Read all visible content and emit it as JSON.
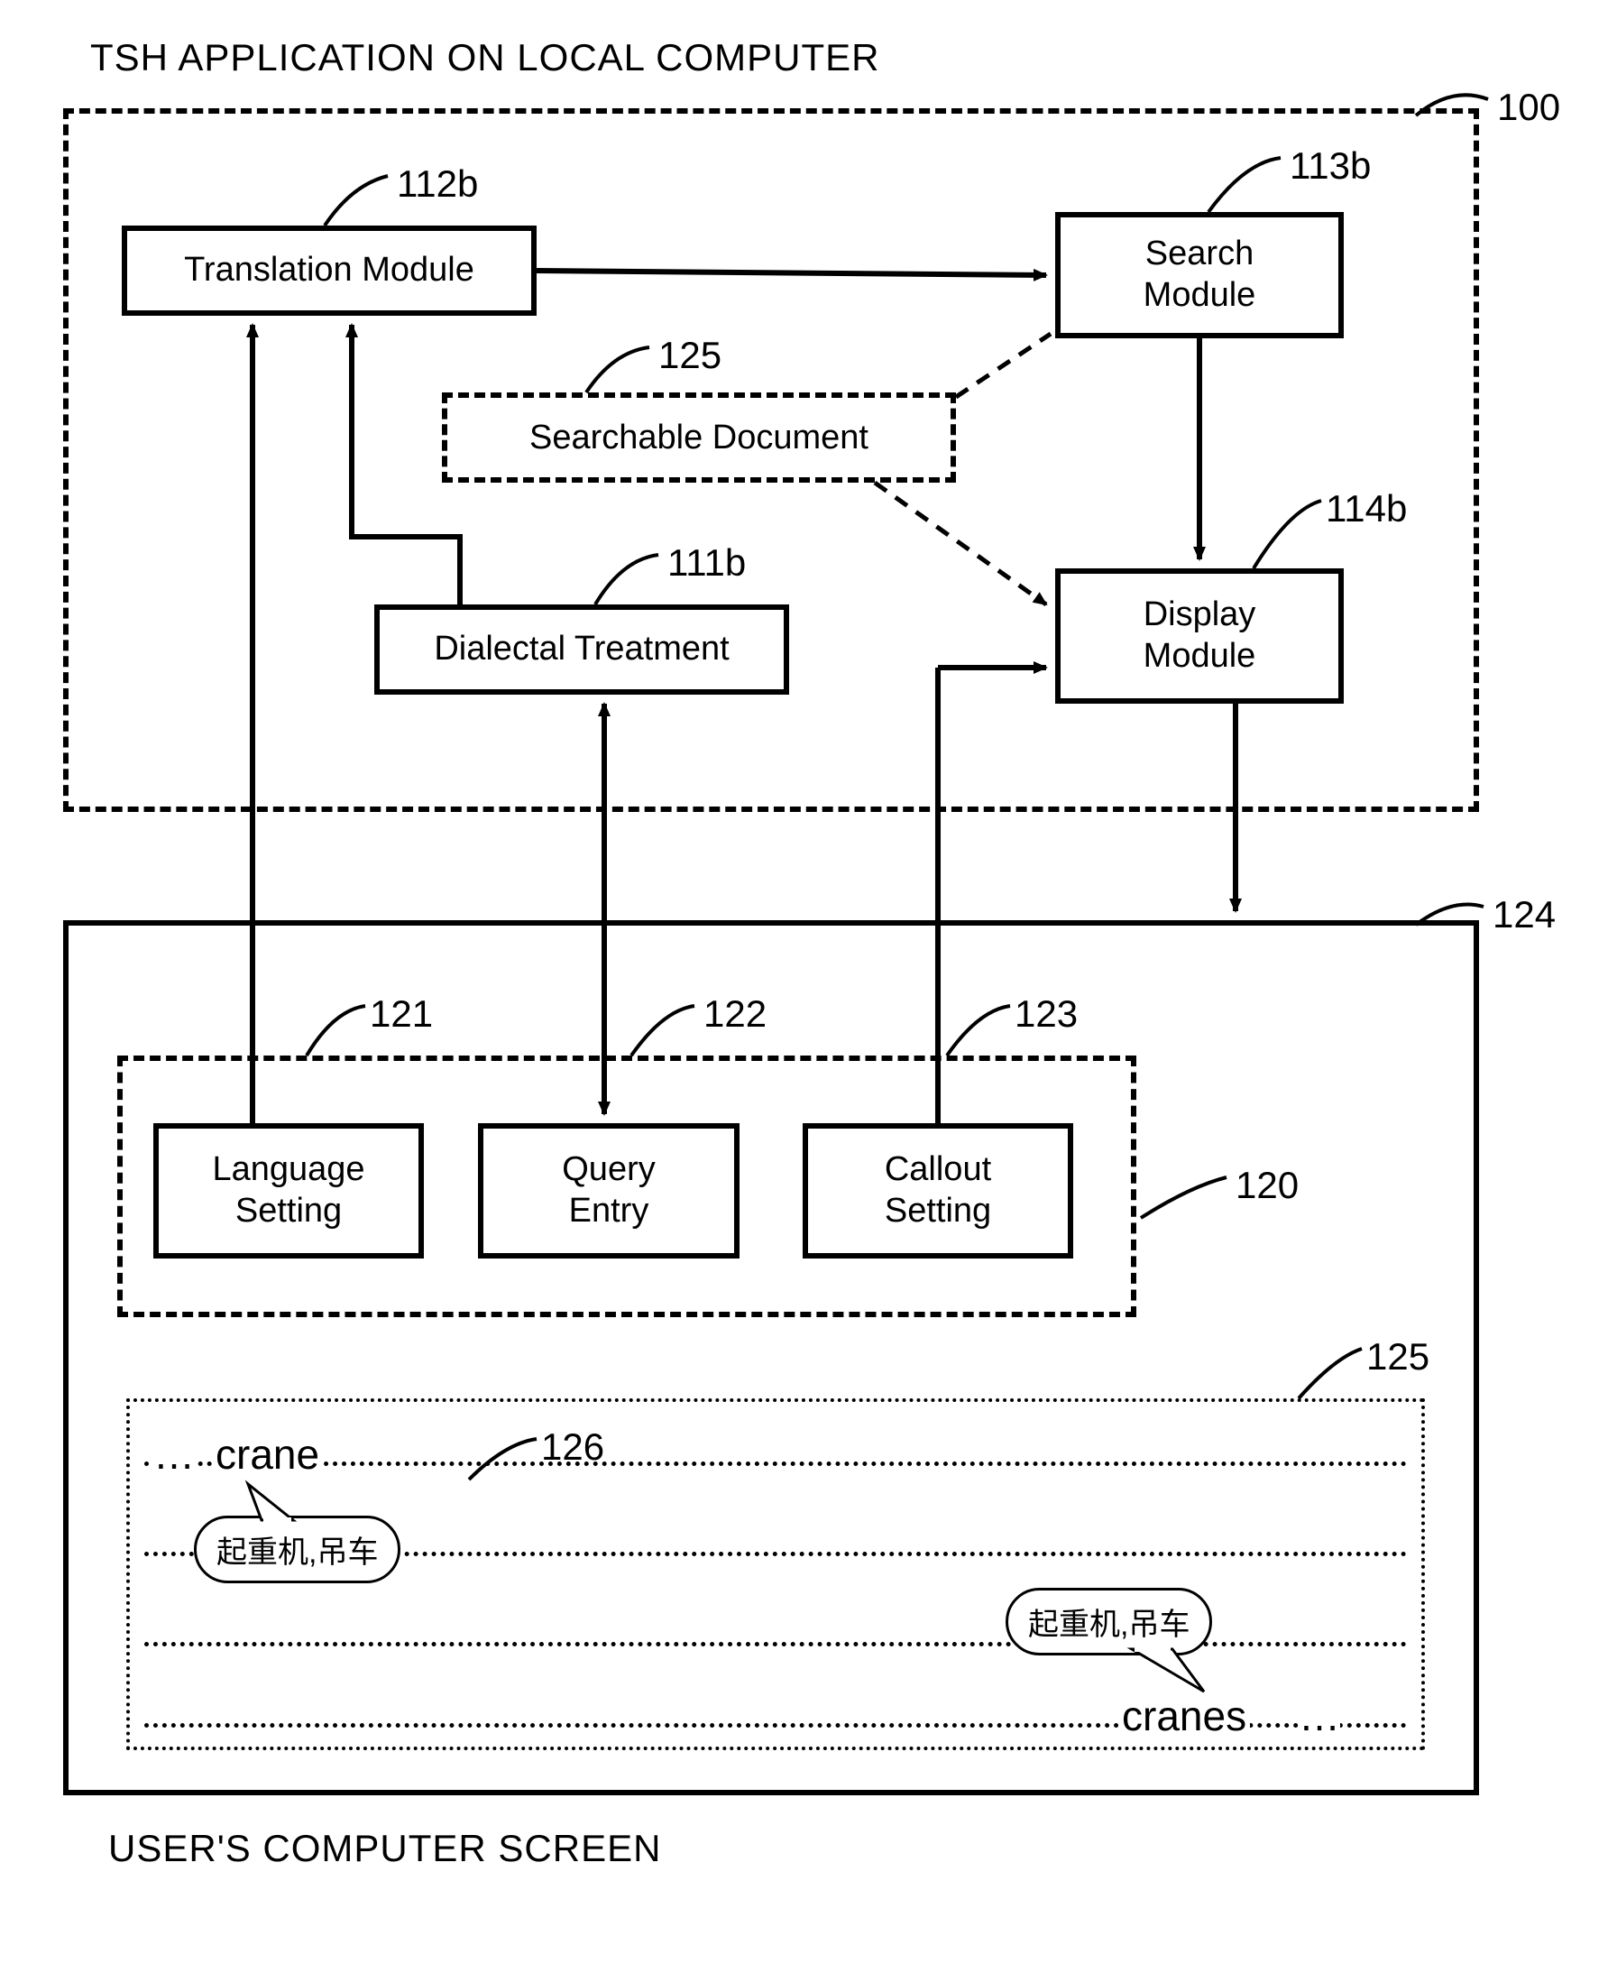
{
  "diagram": {
    "title_top": "TSH APPLICATION ON LOCAL COMPUTER",
    "title_bottom": "USER'S COMPUTER SCREEN",
    "refs": {
      "app_box": "100",
      "translation": "112b",
      "search": "113b",
      "searchable_doc": "125",
      "dialectal": "111b",
      "display": "114b",
      "screen_box": "124",
      "language_setting": "121",
      "query_entry": "122",
      "callout_setting": "123",
      "inner_dashed": "120",
      "doc_area": "125",
      "bubble_ref": "126"
    },
    "boxes": {
      "translation": "Translation Module",
      "search_l1": "Search",
      "search_l2": "Module",
      "searchable_doc": "Searchable Document",
      "dialectal": "Dialectal Treatment",
      "display_l1": "Display",
      "display_l2": "Module",
      "language_l1": "Language",
      "language_l2": "Setting",
      "query_l1": "Query",
      "query_l2": "Entry",
      "callout_l1": "Callout",
      "callout_l2": "Setting"
    },
    "doc": {
      "word1": "crane",
      "word2": "cranes",
      "bubble_text": "起重机,吊车"
    }
  }
}
